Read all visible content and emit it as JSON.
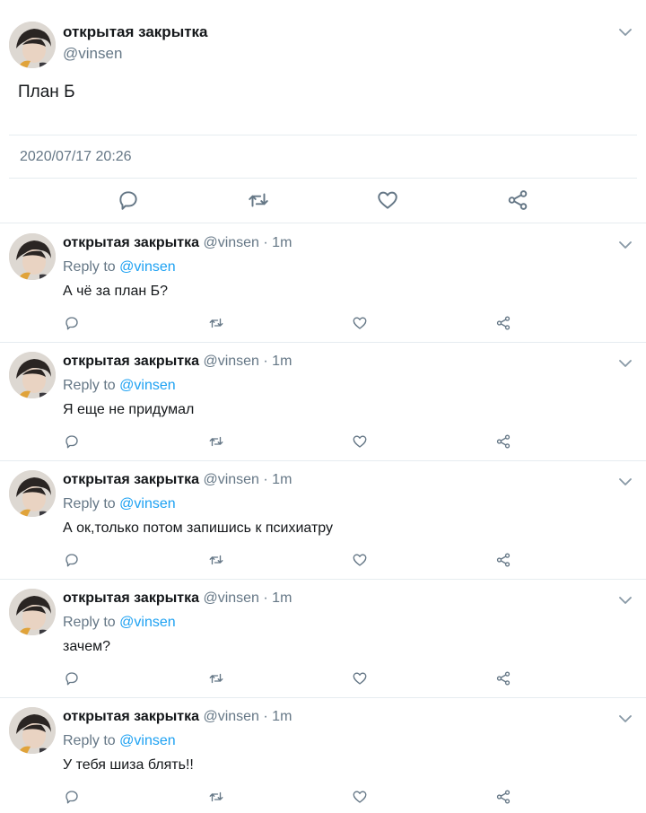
{
  "colors": {
    "text": "#14171a",
    "secondary": "#657786",
    "link": "#1da1f2",
    "divider": "#e6ecf0"
  },
  "tweet": {
    "author_name": "открытая закрытка",
    "author_handle": "@vinsen",
    "text": "План Б",
    "timestamp": "2020/07/17 20:26",
    "actions": [
      "reply-icon",
      "retweet-icon",
      "like-icon",
      "share-icon"
    ]
  },
  "replies": [
    {
      "name": "открытая закрытка",
      "meta": "@vinsen · 1m",
      "reply_to_label": "Reply to",
      "reply_to_handle": "@vinsen",
      "text": "А чё за план Б?"
    },
    {
      "name": "открытая закрытка",
      "meta": "@vinsen · 1m",
      "reply_to_label": "Reply to",
      "reply_to_handle": "@vinsen",
      "text": "Я еще не придумал"
    },
    {
      "name": "открытая закрытка",
      "meta": "@vinsen · 1m",
      "reply_to_label": "Reply to",
      "reply_to_handle": "@vinsen",
      "text": "А ок,только потом запишись к психиатру"
    },
    {
      "name": "открытая закрытка",
      "meta": "@vinsen · 1m",
      "reply_to_label": "Reply to",
      "reply_to_handle": "@vinsen",
      "text": "зачем?"
    },
    {
      "name": "открытая закрытка",
      "meta": "@vinsen · 1m",
      "reply_to_label": "Reply to",
      "reply_to_handle": "@vinsen",
      "text": "У тебя шиза блять!!"
    }
  ]
}
